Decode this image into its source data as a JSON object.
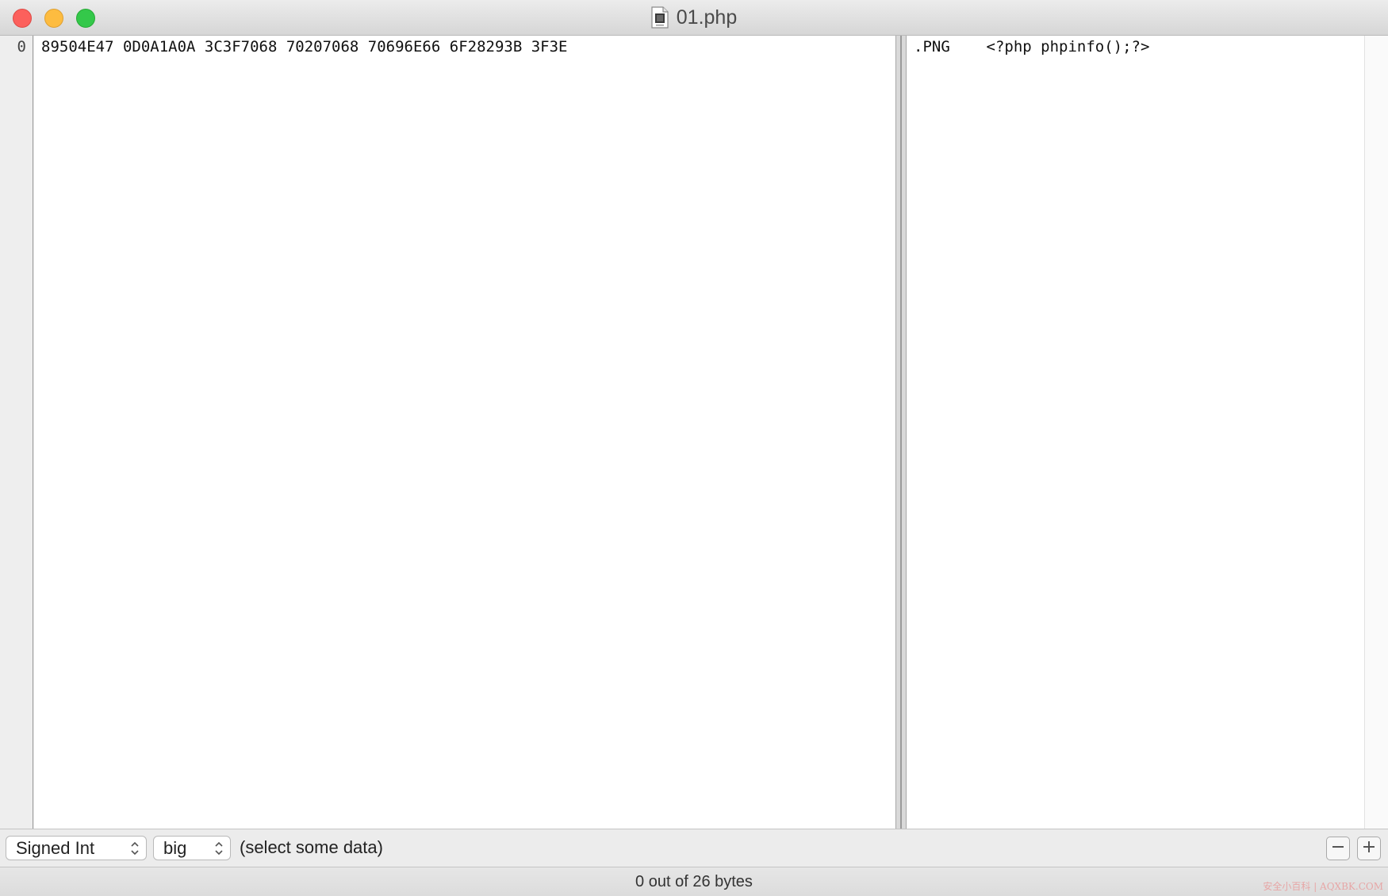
{
  "window": {
    "title": "01.php",
    "file_icon": "php-document-icon"
  },
  "hex_view": {
    "rows": [
      {
        "offset": "0",
        "hex": "89504E47 0D0A1A0A 3C3F7068 70207068 70696E66 6F28293B 3F3E",
        "ascii": ".PNG    <?php phpinfo();?>"
      }
    ]
  },
  "inspector": {
    "type_label": "Signed Int",
    "endian_label": "big",
    "value_text": "(select some data)",
    "minus_icon": "minus-icon",
    "plus_icon": "plus-icon"
  },
  "status": {
    "text": "0 out of 26 bytes"
  },
  "watermark": {
    "text": "安全小百科 | AQXBK.COM"
  },
  "colors": {
    "close": "#fc605c",
    "minimize": "#fdbc40",
    "zoom": "#34c84a",
    "watermark": "#e8a0a0"
  }
}
